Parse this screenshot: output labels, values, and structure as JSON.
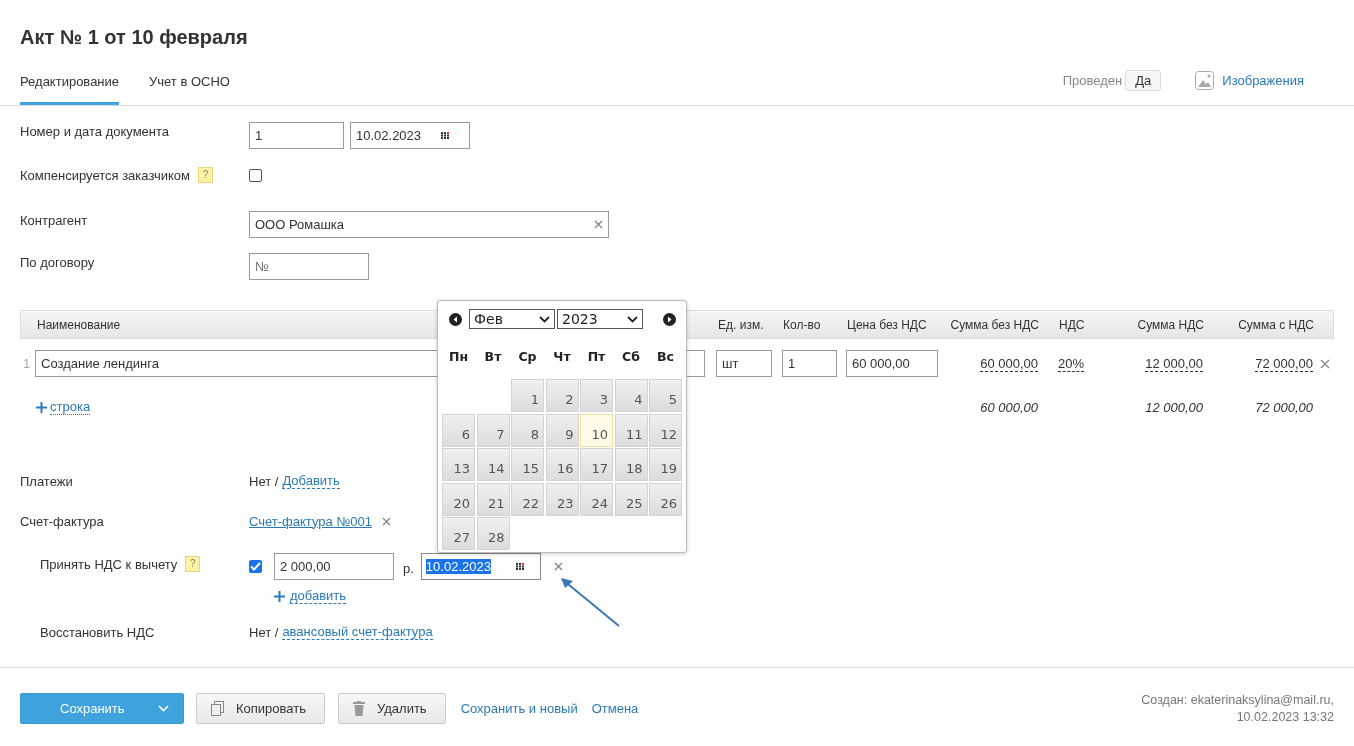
{
  "title": "Акт № 1 от 10 февраля",
  "tabs": [
    {
      "label": "Редактирование",
      "selected": true
    },
    {
      "label": "Учет в ОСНО",
      "selected": false
    }
  ],
  "posted": {
    "label": "Проведен",
    "value": "Да"
  },
  "images_link": "Изображения",
  "doc": {
    "label": "Номер и дата документа",
    "number": "1",
    "date": "10.02.2023"
  },
  "compensated": {
    "label": "Компенсируется заказчиком",
    "help": "?",
    "checked": false
  },
  "counterparty": {
    "label": "Контрагент",
    "value": "ООО Ромашка"
  },
  "contract": {
    "label": "По договору",
    "placeholder": "№"
  },
  "table": {
    "columns": [
      "Наименование",
      "Ед. изм.",
      "Кол-во",
      "Цена без НДС",
      "Сумма без НДС",
      "НДС",
      "Сумма НДС",
      "Сумма с НДС"
    ],
    "rows": [
      {
        "number": "1",
        "name": "Создание лендинга",
        "unit": "шт",
        "qty": "1",
        "price": "60 000,00",
        "sum": "60 000,00",
        "vat_rate": "20%",
        "vat": "12 000,00",
        "total": "72 000,00"
      }
    ],
    "add_row": "строка",
    "totals": {
      "sum": "60 000,00",
      "vat": "12 000,00",
      "total": "72 000,00"
    }
  },
  "payments": {
    "label": "Платежи",
    "value": "Нет /",
    "link": "Добавить"
  },
  "invoice": {
    "label": "Счет-фактура",
    "link": "Счет-фактура №001"
  },
  "vat_deduction": {
    "label": "Принять НДС к вычету",
    "help": "?",
    "checked": true,
    "amount": "2 000,00",
    "currency": "р.",
    "date": "10.02.2023",
    "date_selected": true,
    "add_link": "добавить"
  },
  "vat_restore": {
    "label": "Восстановить НДС",
    "value": "Нет /",
    "link": "авансовый счет-фактура"
  },
  "calendar": {
    "month": "Фев",
    "year": "2023",
    "weekdays": [
      "Пн",
      "Вт",
      "Ср",
      "Чт",
      "Пт",
      "Сб",
      "Вс"
    ],
    "weeks": [
      [
        {
          "day": "1",
          "selected": false
        },
        {
          "day": "2",
          "selected": false
        },
        {
          "day": "3",
          "selected": false
        },
        {
          "day": "4",
          "selected": false
        },
        {
          "day": "5",
          "selected": false
        }
      ],
      [
        {
          "day": "6",
          "selected": false
        },
        {
          "day": "7",
          "selected": false
        },
        {
          "day": "8",
          "selected": false
        },
        {
          "day": "9",
          "selected": false
        },
        {
          "day": "10",
          "selected": true
        },
        {
          "day": "11",
          "selected": false
        },
        {
          "day": "12",
          "selected": false
        }
      ],
      [
        {
          "day": "13",
          "selected": false
        },
        {
          "day": "14",
          "selected": false
        },
        {
          "day": "15",
          "selected": false
        },
        {
          "day": "16",
          "selected": false
        },
        {
          "day": "17",
          "selected": false
        },
        {
          "day": "18",
          "selected": false
        },
        {
          "day": "19",
          "selected": false
        }
      ],
      [
        {
          "day": "20",
          "selected": false
        },
        {
          "day": "21",
          "selected": false
        },
        {
          "day": "22",
          "selected": false
        },
        {
          "day": "23",
          "selected": false
        },
        {
          "day": "24",
          "selected": false
        },
        {
          "day": "25",
          "selected": false
        },
        {
          "day": "26",
          "selected": false
        }
      ],
      [
        {
          "day": "27",
          "selected": false
        },
        {
          "day": "28",
          "selected": false
        }
      ]
    ]
  },
  "footer": {
    "save": "Сохранить",
    "copy": "Копировать",
    "delete": "Удалить",
    "save_new": "Сохранить и новый",
    "cancel": "Отмена",
    "created": "Создан: ekaterinaksylina@mail.ru,",
    "created_at": "10.02.2023 13:32"
  }
}
